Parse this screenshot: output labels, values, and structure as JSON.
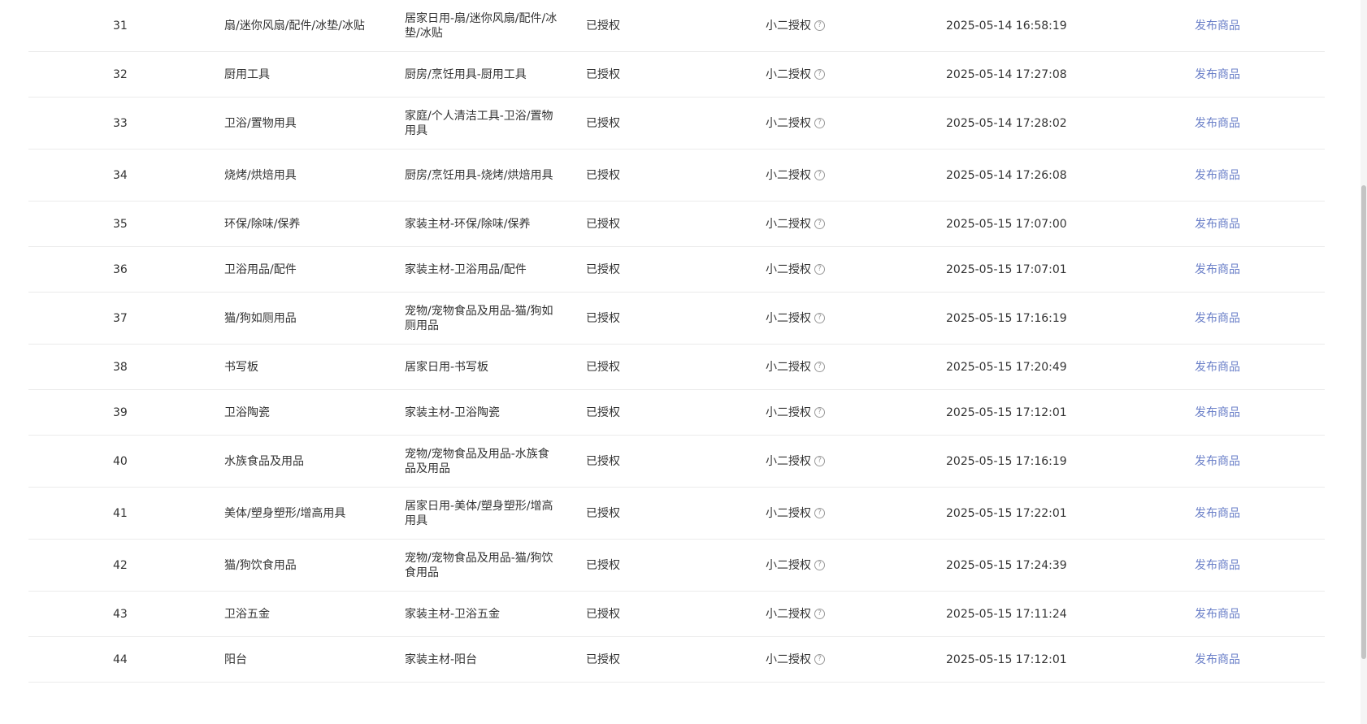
{
  "table": {
    "rows": [
      {
        "index": "31",
        "name": "扇/迷你风扇/配件/冰垫/冰贴",
        "path": "居家日用-扇/迷你风扇/配件/冰垫/冰贴",
        "status": "已授权",
        "auth": "小二授权",
        "time": "2025-05-14 16:58:19",
        "action": "发布商品"
      },
      {
        "index": "32",
        "name": "厨用工具",
        "path": "厨房/烹饪用具-厨用工具",
        "status": "已授权",
        "auth": "小二授权",
        "time": "2025-05-14 17:27:08",
        "action": "发布商品"
      },
      {
        "index": "33",
        "name": "卫浴/置物用具",
        "path": "家庭/个人清洁工具-卫浴/置物用具",
        "status": "已授权",
        "auth": "小二授权",
        "time": "2025-05-14 17:28:02",
        "action": "发布商品"
      },
      {
        "index": "34",
        "name": "烧烤/烘焙用具",
        "path": "厨房/烹饪用具-烧烤/烘焙用具",
        "status": "已授权",
        "auth": "小二授权",
        "time": "2025-05-14 17:26:08",
        "action": "发布商品"
      },
      {
        "index": "35",
        "name": "环保/除味/保养",
        "path": "家装主材-环保/除味/保养",
        "status": "已授权",
        "auth": "小二授权",
        "time": "2025-05-15 17:07:00",
        "action": "发布商品"
      },
      {
        "index": "36",
        "name": "卫浴用品/配件",
        "path": "家装主材-卫浴用品/配件",
        "status": "已授权",
        "auth": "小二授权",
        "time": "2025-05-15 17:07:01",
        "action": "发布商品"
      },
      {
        "index": "37",
        "name": "猫/狗如厕用品",
        "path": "宠物/宠物食品及用品-猫/狗如厕用品",
        "status": "已授权",
        "auth": "小二授权",
        "time": "2025-05-15 17:16:19",
        "action": "发布商品"
      },
      {
        "index": "38",
        "name": "书写板",
        "path": "居家日用-书写板",
        "status": "已授权",
        "auth": "小二授权",
        "time": "2025-05-15 17:20:49",
        "action": "发布商品"
      },
      {
        "index": "39",
        "name": "卫浴陶瓷",
        "path": "家装主材-卫浴陶瓷",
        "status": "已授权",
        "auth": "小二授权",
        "time": "2025-05-15 17:12:01",
        "action": "发布商品"
      },
      {
        "index": "40",
        "name": "水族食品及用品",
        "path": "宠物/宠物食品及用品-水族食品及用品",
        "status": "已授权",
        "auth": "小二授权",
        "time": "2025-05-15 17:16:19",
        "action": "发布商品"
      },
      {
        "index": "41",
        "name": "美体/塑身塑形/增高用具",
        "path": "居家日用-美体/塑身塑形/增高用具",
        "status": "已授权",
        "auth": "小二授权",
        "time": "2025-05-15 17:22:01",
        "action": "发布商品"
      },
      {
        "index": "42",
        "name": "猫/狗饮食用品",
        "path": "宠物/宠物食品及用品-猫/狗饮食用品",
        "status": "已授权",
        "auth": "小二授权",
        "time": "2025-05-15 17:24:39",
        "action": "发布商品"
      },
      {
        "index": "43",
        "name": "卫浴五金",
        "path": "家装主材-卫浴五金",
        "status": "已授权",
        "auth": "小二授权",
        "time": "2025-05-15 17:11:24",
        "action": "发布商品"
      },
      {
        "index": "44",
        "name": "阳台",
        "path": "家装主材-阳台",
        "status": "已授权",
        "auth": "小二授权",
        "time": "2025-05-15 17:12:01",
        "action": "发布商品"
      }
    ]
  }
}
